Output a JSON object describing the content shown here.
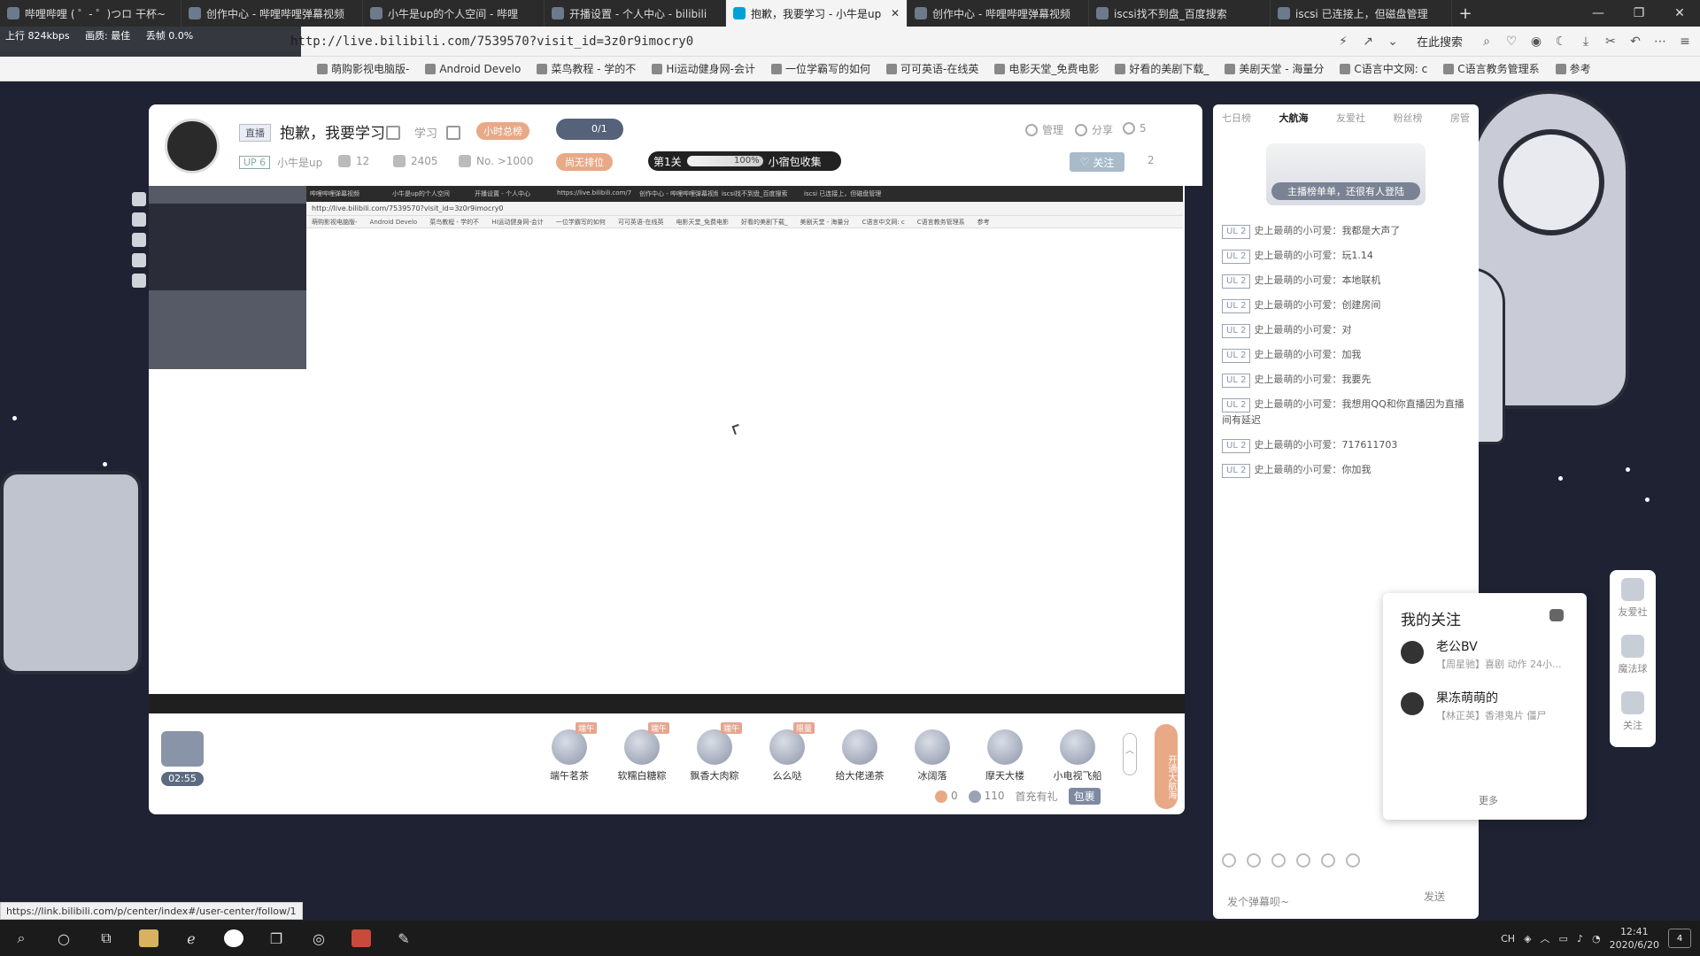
{
  "browser": {
    "tabs": [
      {
        "label": "哔哩哔哩 ( ゜- ゜)つロ 干杯~",
        "active": false
      },
      {
        "label": "创作中心 - 哔哩哔哩弹幕视频",
        "active": false
      },
      {
        "label": "小牛是up的个人空间 - 哔哩",
        "active": false
      },
      {
        "label": "开播设置 - 个人中心 - bilibili",
        "active": false
      },
      {
        "label": "抱歉，我要学习 - 小牛是up",
        "active": true
      },
      {
        "label": "创作中心 - 哔哩哔哩弹幕视频",
        "active": false
      },
      {
        "label": "iscsi找不到盘_百度搜索",
        "active": false
      },
      {
        "label": "iscsi 已连接上，但磁盘管理",
        "active": false
      }
    ],
    "close_tab": "✕",
    "new_tab": "+",
    "url": "http://live.bilibili.com/7539570?visit_id=3z0r9imocry0",
    "search_engine": "在此搜索",
    "stats": {
      "upload": "上行 824kbps",
      "quality": "画质: 最佳",
      "drop": "丢帧 0.0%"
    },
    "bookmarks": [
      "萌购影视电脑版-",
      "Android Develo",
      "菜鸟教程 - 学的不",
      "Hi运动健身网-会计",
      "一位学霸写的如何",
      "可可英语-在线英",
      "电影天堂_免费电影",
      "好看的美剧下载_",
      "美剧天堂 - 海量分",
      "C语言中文网: c",
      "C语言教务管理系",
      "参考"
    ]
  },
  "room": {
    "live_tag": "直播",
    "title": "抱歉，我要学习",
    "area": "学习",
    "hour_rank": "小时总榜",
    "guard_count": "0/1",
    "up_level": "UP 6",
    "up_name": "小牛是up",
    "fans": "12",
    "gifts": "2405",
    "rank": "No. >1000",
    "no_rank_badge": "尚无排位",
    "level_stage": "第1关",
    "level_percent": "100%",
    "level_collect": "小宿包收集",
    "manage": "管理",
    "share": "分享",
    "viewers": "5",
    "follow": "关注",
    "follow_count": "2"
  },
  "player": {
    "inner_url": "http://live.bilibili.com/7539570?visit_id=3z0r9imocry0",
    "inner_tabs": [
      "哔哩哔哩弹幕视频",
      "小牛是up的个人空间",
      "开播设置 - 个人中心",
      "https://live.bilibili.com/7",
      "创作中心 - 哔哩哔哩弹幕视频",
      "iscsi找不到盘_百度搜索",
      "iscsi 已连接上，但磁盘管理"
    ]
  },
  "gift_bar": {
    "stream_time": "02:55",
    "gifts": [
      {
        "name": "端午茗茶",
        "badge": "端午"
      },
      {
        "name": "软糯白糖粽",
        "badge": "端午"
      },
      {
        "name": "飘香大肉粽",
        "badge": "端午"
      },
      {
        "name": "么么哒",
        "badge": "限量"
      },
      {
        "name": "给大佬递茶",
        "badge": ""
      },
      {
        "name": "冰阔落",
        "badge": ""
      },
      {
        "name": "摩天大楼",
        "badge": ""
      },
      {
        "name": "小电视飞船",
        "badge": ""
      }
    ],
    "open_guard": "开通大航海",
    "gold": "0",
    "silver": "110",
    "recharge": "首充有礼",
    "pack": "包裹"
  },
  "chat": {
    "rank_tabs": [
      "七日榜",
      "大航海",
      "友爱社",
      "粉丝榜",
      "房管"
    ],
    "rank_banner": "主播榜单单，还很有人登陆",
    "messages": [
      {
        "level": "UL 2",
        "user": "史上最萌的小可爱：",
        "text": "我都是大声了"
      },
      {
        "level": "UL 2",
        "user": "史上最萌的小可爱：",
        "text": "玩1.14"
      },
      {
        "level": "UL 2",
        "user": "史上最萌的小可爱：",
        "text": "本地联机"
      },
      {
        "level": "UL 2",
        "user": "史上最萌的小可爱：",
        "text": "创建房间"
      },
      {
        "level": "UL 2",
        "user": "史上最萌的小可爱：",
        "text": "对"
      },
      {
        "level": "UL 2",
        "user": "史上最萌的小可爱：",
        "text": "加我"
      },
      {
        "level": "UL 2",
        "user": "史上最萌的小可爱：",
        "text": "我要先"
      },
      {
        "level": "UL 2",
        "user": "史上最萌的小可爱：",
        "text": "我想用QQ和你直播因为直播间有延迟"
      },
      {
        "level": "UL 2",
        "user": "史上最萌的小可爱：",
        "text": "717611703"
      },
      {
        "level": "UL 2",
        "user": "史上最萌的小可爱：",
        "text": "你加我"
      }
    ],
    "input_placeholder": "发个弹幕呗~",
    "send": "发送"
  },
  "follow_popover": {
    "title": "我的关注",
    "items": [
      {
        "name": "老公BV",
        "sub": "【周星驰】喜剧 动作 24小..."
      },
      {
        "name": "果冻萌萌的",
        "sub": "【林正英】香港鬼片 僵尸"
      }
    ],
    "more": "更多"
  },
  "float_nav": [
    "友爱社",
    "魔法球",
    "关注"
  ],
  "status_url": "https://link.bilibili.com/p/center/index#/user-center/follow/1",
  "taskbar": {
    "time": "12:41",
    "date": "2020/6/20",
    "ime": "CH",
    "notifications": "4"
  }
}
